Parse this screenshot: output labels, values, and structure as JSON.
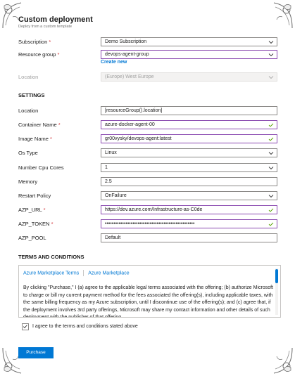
{
  "header": {
    "title": "Custom deployment",
    "subtitle": "Deploy from a custom template"
  },
  "basics": {
    "subscription": {
      "label": "Subscription",
      "required": "*",
      "value": "Demo Subscription"
    },
    "resource_group": {
      "label": "Resource group",
      "required": "*",
      "value": "devops-agent-group",
      "create_new": "Create new"
    },
    "location": {
      "label": "Location",
      "value": "(Europe) West Europe"
    }
  },
  "settings": {
    "heading": "SETTINGS",
    "fields": {
      "location": {
        "label": "Location",
        "value": "[resourceGroup().location]"
      },
      "container_name": {
        "label": "Container Name",
        "required": "*",
        "value": "azure-docker-agent-00"
      },
      "image_name": {
        "label": "Image Name",
        "required": "*",
        "value": "gr00vysky/devops-agent:latest"
      },
      "os_type": {
        "label": "Os Type",
        "value": "Linux"
      },
      "cpu_cores": {
        "label": "Number Cpu Cores",
        "value": "1"
      },
      "memory": {
        "label": "Memory",
        "value": "2.5"
      },
      "restart_policy": {
        "label": "Restart Policy",
        "value": "OnFailure"
      },
      "azp_url": {
        "label": "AZP_URL",
        "required": "*",
        "value": "https://dev.azure.com/Infrastructure-as-C0de"
      },
      "azp_token": {
        "label": "AZP_TOKEN",
        "required": "*",
        "value": "••••••••••••••••••••••••••••••••••••••••••••••••••••"
      },
      "azp_pool": {
        "label": "AZP_POOL",
        "value": "Default"
      }
    }
  },
  "terms": {
    "heading": "TERMS AND CONDITIONS",
    "tab1": "Azure Marketplace Terms",
    "tab2": "Azure Marketplace",
    "body": "By clicking \"Purchase,\" I (a) agree to the applicable legal terms associated with the offering; (b) authorize Microsoft to charge or bill my current payment method for the fees associated the offering(s), including applicable taxes, with the same billing frequency as my Azure subscription, until I discontinue use of the offering(s); and (c) agree that, if the deployment involves 3rd party offerings, Microsoft may share my contact information and other details of such deployment with the publisher of that offering.",
    "agree_label": "I agree to the terms and conditions stated above"
  },
  "actions": {
    "purchase": "Purchase"
  },
  "colors": {
    "accent": "#0078d4",
    "required": "#d13438",
    "highlight_border": "#8a4ab0",
    "valid_tick": "#57a300"
  },
  "icons": {
    "dropdown": "chevron-down-icon",
    "valid": "checkmark-icon",
    "corner": "ornament-icon"
  }
}
